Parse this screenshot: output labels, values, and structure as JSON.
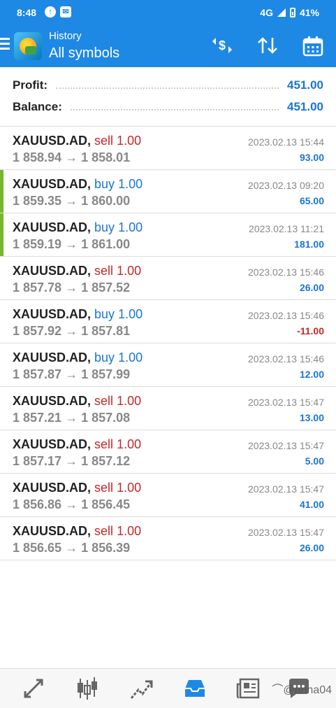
{
  "status_bar": {
    "time": "8:48",
    "network": "4G",
    "battery": "41%"
  },
  "toolbar": {
    "subtitle": "History",
    "title": "All symbols"
  },
  "summary": {
    "profit_label": "Profit:",
    "profit_value": "451.00",
    "balance_label": "Balance:",
    "balance_value": "451.00"
  },
  "trades": [
    {
      "symbol": "XAUUSD.AD,",
      "side": "sell",
      "volume": "1.00",
      "open": "1 858.94",
      "arrow": "→",
      "close": "1 858.01",
      "time": "2023.02.13 15:44",
      "profit": "93.00",
      "profit_sign": "pos",
      "marker": false
    },
    {
      "symbol": "XAUUSD.AD,",
      "side": "buy",
      "volume": "1.00",
      "open": "1 859.35",
      "arrow": "→",
      "close": "1 860.00",
      "time": "2023.02.13 09:20",
      "profit": "65.00",
      "profit_sign": "pos",
      "marker": true
    },
    {
      "symbol": "XAUUSD.AD,",
      "side": "buy",
      "volume": "1.00",
      "open": "1 859.19",
      "arrow": "→",
      "close": "1 861.00",
      "time": "2023.02.13 11:21",
      "profit": "181.00",
      "profit_sign": "pos",
      "marker": true
    },
    {
      "symbol": "XAUUSD.AD,",
      "side": "sell",
      "volume": "1.00",
      "open": "1 857.78",
      "arrow": "→",
      "close": "1 857.52",
      "time": "2023.02.13 15:46",
      "profit": "26.00",
      "profit_sign": "pos",
      "marker": false
    },
    {
      "symbol": "XAUUSD.AD,",
      "side": "buy",
      "volume": "1.00",
      "open": "1 857.92",
      "arrow": "→",
      "close": "1 857.81",
      "time": "2023.02.13 15:46",
      "profit": "-11.00",
      "profit_sign": "neg",
      "marker": false
    },
    {
      "symbol": "XAUUSD.AD,",
      "side": "buy",
      "volume": "1.00",
      "open": "1 857.87",
      "arrow": "→",
      "close": "1 857.99",
      "time": "2023.02.13 15:46",
      "profit": "12.00",
      "profit_sign": "pos",
      "marker": false
    },
    {
      "symbol": "XAUUSD.AD,",
      "side": "sell",
      "volume": "1.00",
      "open": "1 857.21",
      "arrow": "→",
      "close": "1 857.08",
      "time": "2023.02.13 15:47",
      "profit": "13.00",
      "profit_sign": "pos",
      "marker": false
    },
    {
      "symbol": "XAUUSD.AD,",
      "side": "sell",
      "volume": "1.00",
      "open": "1 857.17",
      "arrow": "→",
      "close": "1 857.12",
      "time": "2023.02.13 15:47",
      "profit": "5.00",
      "profit_sign": "pos",
      "marker": false
    },
    {
      "symbol": "XAUUSD.AD,",
      "side": "sell",
      "volume": "1.00",
      "open": "1 856.86",
      "arrow": "→",
      "close": "1 856.45",
      "time": "2023.02.13 15:47",
      "profit": "41.00",
      "profit_sign": "pos",
      "marker": false
    },
    {
      "symbol": "XAUUSD.AD,",
      "side": "sell",
      "volume": "1.00",
      "open": "1 856.65",
      "arrow": "→",
      "close": "1 856.39",
      "time": "2023.02.13 15:47",
      "profit": "26.00",
      "profit_sign": "pos",
      "marker": false
    }
  ],
  "bottom_nav": [
    {
      "name": "nav-quotes",
      "icon": "arrows-updown-icon"
    },
    {
      "name": "nav-chart",
      "icon": "candlestick-icon"
    },
    {
      "name": "nav-trade",
      "icon": "trend-line-icon"
    },
    {
      "name": "nav-history",
      "icon": "inbox-icon",
      "active": true
    },
    {
      "name": "nav-news",
      "icon": "newspaper-icon"
    },
    {
      "name": "nav-messages",
      "icon": "chat-bubble-icon"
    }
  ],
  "watermark": "⌒@anna04",
  "colors": {
    "accent": "#1e88e5",
    "profit_blue": "#1976d2",
    "loss_red": "#c62828",
    "buy_marker": "#76b82a"
  }
}
